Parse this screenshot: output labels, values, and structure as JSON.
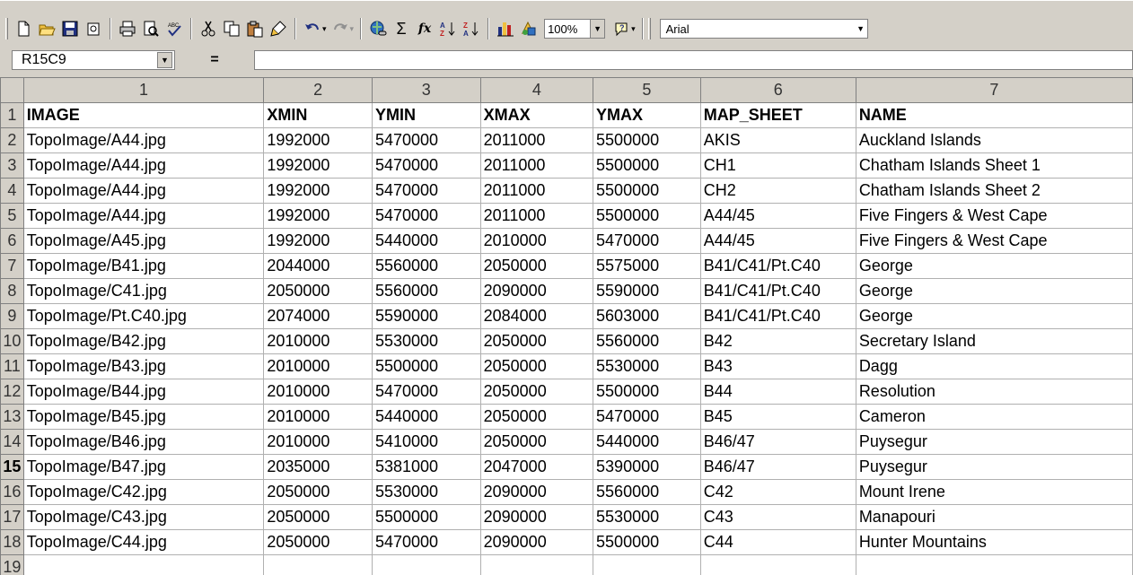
{
  "toolbar": {
    "buttons": [
      "new",
      "open",
      "save",
      "permission",
      "print",
      "print-preview",
      "spelling",
      "cut",
      "copy",
      "paste",
      "format-painter",
      "undo",
      "redo",
      "insert-hyperlink",
      "autosum",
      "function",
      "sort-ascending",
      "sort-descending",
      "chart-wizard",
      "drawing",
      "help"
    ],
    "sum_glyph": "Σ",
    "fx_glyph": "fx",
    "zoom": "100%",
    "font": "Arial"
  },
  "formula_bar": {
    "name_box": "R15C9",
    "equals": "=",
    "value": ""
  },
  "sheet": {
    "column_headers": [
      "1",
      "2",
      "3",
      "4",
      "5",
      "6",
      "7"
    ],
    "active_row": 15,
    "rows": [
      {
        "num": "1",
        "cells": [
          "IMAGE",
          "XMIN",
          "YMIN",
          "XMAX",
          "YMAX",
          "MAP_SHEET",
          "NAME"
        ]
      },
      {
        "num": "2",
        "cells": [
          "TopoImage/A44.jpg",
          "1992000",
          "5470000",
          "2011000",
          "5500000",
          "AKIS",
          "Auckland Islands"
        ]
      },
      {
        "num": "3",
        "cells": [
          "TopoImage/A44.jpg",
          "1992000",
          "5470000",
          "2011000",
          "5500000",
          "CH1",
          "Chatham Islands Sheet 1"
        ]
      },
      {
        "num": "4",
        "cells": [
          "TopoImage/A44.jpg",
          "1992000",
          "5470000",
          "2011000",
          "5500000",
          "CH2",
          "Chatham Islands Sheet 2"
        ]
      },
      {
        "num": "5",
        "cells": [
          "TopoImage/A44.jpg",
          "1992000",
          "5470000",
          "2011000",
          "5500000",
          "A44/45",
          "Five Fingers & West Cape"
        ]
      },
      {
        "num": "6",
        "cells": [
          "TopoImage/A45.jpg",
          "1992000",
          "5440000",
          "2010000",
          "5470000",
          "A44/45",
          "Five Fingers & West Cape"
        ]
      },
      {
        "num": "7",
        "cells": [
          "TopoImage/B41.jpg",
          "2044000",
          "5560000",
          "2050000",
          "5575000",
          "B41/C41/Pt.C40",
          "George"
        ]
      },
      {
        "num": "8",
        "cells": [
          "TopoImage/C41.jpg",
          "2050000",
          "5560000",
          "2090000",
          "5590000",
          "B41/C41/Pt.C40",
          "George"
        ]
      },
      {
        "num": "9",
        "cells": [
          "TopoImage/Pt.C40.jpg",
          "2074000",
          "5590000",
          "2084000",
          "5603000",
          "B41/C41/Pt.C40",
          "George"
        ]
      },
      {
        "num": "10",
        "cells": [
          "TopoImage/B42.jpg",
          "2010000",
          "5530000",
          "2050000",
          "5560000",
          "B42",
          "Secretary Island"
        ]
      },
      {
        "num": "11",
        "cells": [
          "TopoImage/B43.jpg",
          "2010000",
          "5500000",
          "2050000",
          "5530000",
          "B43",
          "Dagg"
        ]
      },
      {
        "num": "12",
        "cells": [
          "TopoImage/B44.jpg",
          "2010000",
          "5470000",
          "2050000",
          "5500000",
          "B44",
          "Resolution"
        ]
      },
      {
        "num": "13",
        "cells": [
          "TopoImage/B45.jpg",
          "2010000",
          "5440000",
          "2050000",
          "5470000",
          "B45",
          "Cameron"
        ]
      },
      {
        "num": "14",
        "cells": [
          "TopoImage/B46.jpg",
          "2010000",
          "5410000",
          "2050000",
          "5440000",
          "B46/47",
          "Puysegur"
        ]
      },
      {
        "num": "15",
        "cells": [
          "TopoImage/B47.jpg",
          "2035000",
          "5381000",
          "2047000",
          "5390000",
          "B46/47",
          "Puysegur"
        ]
      },
      {
        "num": "16",
        "cells": [
          "TopoImage/C42.jpg",
          "2050000",
          "5530000",
          "2090000",
          "5560000",
          "C42",
          "Mount Irene"
        ]
      },
      {
        "num": "17",
        "cells": [
          "TopoImage/C43.jpg",
          "2050000",
          "5500000",
          "2090000",
          "5530000",
          "C43",
          "Manapouri"
        ]
      },
      {
        "num": "18",
        "cells": [
          "TopoImage/C44.jpg",
          "2050000",
          "5470000",
          "2090000",
          "5500000",
          "C44",
          "Hunter Mountains"
        ]
      },
      {
        "num": "19",
        "cells": [
          "",
          "",
          "",
          "",
          "",
          "",
          ""
        ]
      }
    ]
  }
}
